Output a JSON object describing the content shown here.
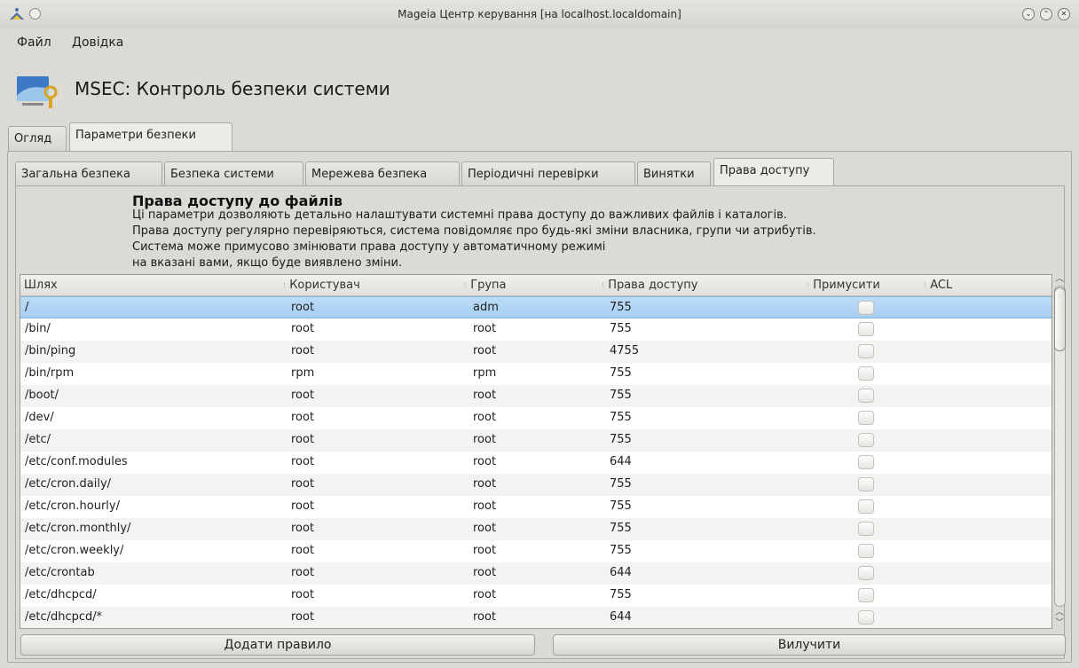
{
  "window": {
    "title": "Mageia Центр керування  [на localhost.localdomain]"
  },
  "menu": {
    "file": "Файл",
    "help": "Довідка"
  },
  "header": {
    "title": "MSEC: Контроль безпеки системи"
  },
  "outer_tabs": [
    {
      "label": "Огляд"
    },
    {
      "label": "Параметри безпеки"
    }
  ],
  "inner_tabs": [
    {
      "label": "Загальна безпека"
    },
    {
      "label": "Безпека системи"
    },
    {
      "label": "Мережева безпека"
    },
    {
      "label": "Періодичні перевірки"
    },
    {
      "label": "Винятки"
    },
    {
      "label": "Права доступу"
    }
  ],
  "description": {
    "title": "Права доступу до файлів",
    "lines": [
      "Ці параметри дозволяють детально налаштувати системні права доступу до важливих файлів і каталогів.",
      "Права доступу регулярно перевіряються, система повідомляє про будь-які зміни власника, групи чи атрибутів.",
      "Система може примусово змінювати права доступу у автоматичному режимі",
      "на вказані вами, якщо буде виявлено зміни."
    ]
  },
  "table": {
    "columns": [
      "Шлях",
      "Користувач",
      "Група",
      "Права доступу",
      "Примусити",
      "ACL"
    ],
    "rows": [
      {
        "path": "/",
        "user": "root",
        "group": "adm",
        "perm": "755"
      },
      {
        "path": "/bin/",
        "user": "root",
        "group": "root",
        "perm": "755"
      },
      {
        "path": "/bin/ping",
        "user": "root",
        "group": "root",
        "perm": "4755"
      },
      {
        "path": "/bin/rpm",
        "user": "rpm",
        "group": "rpm",
        "perm": "755"
      },
      {
        "path": "/boot/",
        "user": "root",
        "group": "root",
        "perm": "755"
      },
      {
        "path": "/dev/",
        "user": "root",
        "group": "root",
        "perm": "755"
      },
      {
        "path": "/etc/",
        "user": "root",
        "group": "root",
        "perm": "755"
      },
      {
        "path": "/etc/conf.modules",
        "user": "root",
        "group": "root",
        "perm": "644"
      },
      {
        "path": "/etc/cron.daily/",
        "user": "root",
        "group": "root",
        "perm": "755"
      },
      {
        "path": "/etc/cron.hourly/",
        "user": "root",
        "group": "root",
        "perm": "755"
      },
      {
        "path": "/etc/cron.monthly/",
        "user": "root",
        "group": "root",
        "perm": "755"
      },
      {
        "path": "/etc/cron.weekly/",
        "user": "root",
        "group": "root",
        "perm": "755"
      },
      {
        "path": "/etc/crontab",
        "user": "root",
        "group": "root",
        "perm": "644"
      },
      {
        "path": "/etc/dhcpcd/",
        "user": "root",
        "group": "root",
        "perm": "755"
      },
      {
        "path": "/etc/dhcpcd/*",
        "user": "root",
        "group": "root",
        "perm": "644"
      }
    ]
  },
  "buttons": {
    "add": "Додати правило",
    "remove": "Вилучити"
  },
  "colors": {
    "selection": "#a6cff2",
    "window_bg": "#dcdad5"
  }
}
